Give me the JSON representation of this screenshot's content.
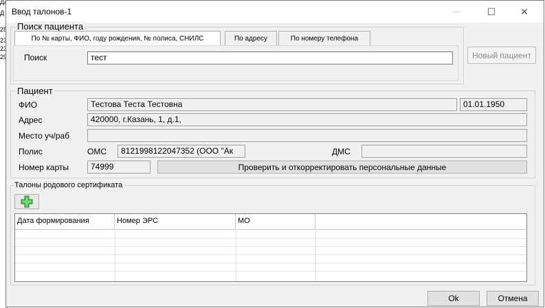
{
  "background_fragments": [
    "Да",
    "Д",
    "25",
    "23",
    "23",
    "29"
  ],
  "window": {
    "title": "Ввод талонов-1",
    "minimize_glyph": "—",
    "maximize_glyph": "☐",
    "close_glyph": "✕"
  },
  "search": {
    "group_title": "Поиск пациента",
    "tabs": [
      "По № карты, ФИО, году рождения, № полиса, СНИЛС",
      "По адресу",
      "По номеру телефона"
    ],
    "label": "Поиск",
    "value": "тест",
    "new_patient_button": "Новый пациент"
  },
  "patient": {
    "group_title": "Пациент",
    "fio_label": "ФИО",
    "fio_value": "Тестова Теста Тестовна",
    "birth_date": "01.01.1950",
    "address_label": "Адрес",
    "address_value": "420000, г.Казань, 1, д.1,",
    "study_place_label": "Место уч/раб",
    "study_place_value": "",
    "policy_label": "Полис",
    "oms_label": "ОМС",
    "oms_value": "8121998122047352 (ООО \"Ак",
    "dms_label": "ДМС",
    "dms_value": "",
    "card_label": "Номер карты",
    "card_value": "74999",
    "verify_button": "Проверить и откорректировать персональные данные"
  },
  "certificates": {
    "group_title": "Талоны родового сертификата",
    "add_icon": "add-plus-icon",
    "columns": [
      "Дата формирования",
      "Номер ЭРС",
      "МО",
      ""
    ],
    "rows": []
  },
  "footer": {
    "ok_button": "Ok",
    "cancel_button": "Отмена"
  },
  "colors": {
    "dialog_bg": "#f0f0f0",
    "add_icon_green": "#3aa83a"
  }
}
